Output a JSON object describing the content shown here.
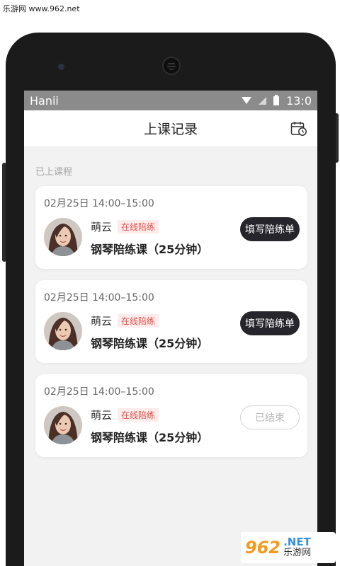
{
  "watermark": {
    "top_text": "乐游网 www.962.net",
    "logo_num": "962",
    "logo_net": ".NET",
    "logo_cn": "乐游网"
  },
  "statusbar": {
    "carrier": "Hanii",
    "time": "13:0"
  },
  "navbar": {
    "title": "上课记录",
    "calendar_icon": "calendar-clock-icon"
  },
  "section": {
    "label": "已上课程"
  },
  "records": [
    {
      "time": "02月25日 14:00–15:00",
      "teacher": "萌云",
      "tag": "在线陪练",
      "course": "钢琴陪练课（25分钟）",
      "action": "填写陪练单",
      "state": "pending"
    },
    {
      "time": "02月25日 14:00–15:00",
      "teacher": "萌云",
      "tag": "在线陪练",
      "course": "钢琴陪练课（25分钟）",
      "action": "填写陪练单",
      "state": "pending"
    },
    {
      "time": "02月25日 14:00–15:00",
      "teacher": "萌云",
      "tag": "在线陪练",
      "course": "钢琴陪练课（25分钟）",
      "action": "已结束",
      "state": "ended"
    }
  ],
  "colors": {
    "accent_dark": "#26252b",
    "tag_red": "#e3504a",
    "tag_bg": "#fdeceb",
    "statusbar": "#8b8b8b"
  }
}
